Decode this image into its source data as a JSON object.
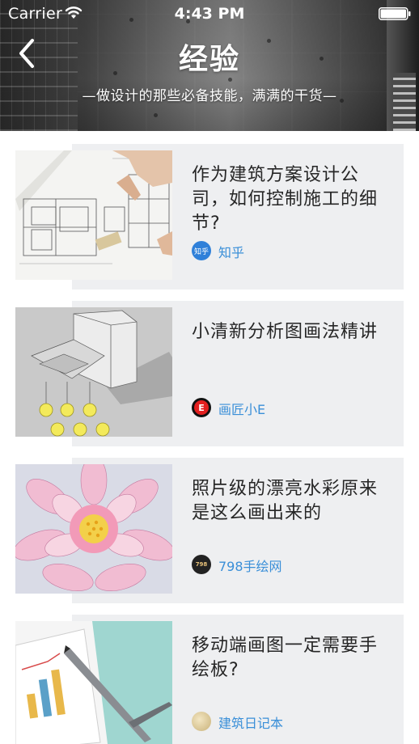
{
  "status_bar": {
    "carrier": "Carrier",
    "time": "4:43 PM"
  },
  "nav": {
    "back_icon": "chevron-left-icon",
    "title": "经验",
    "subtitle": "—做设计的那些必备技能，满满的干货—"
  },
  "colors": {
    "card_background": "#eeeff1",
    "source_link": "#3a8fd8",
    "title_text": "#262626"
  },
  "articles": [
    {
      "title": "作为建筑方案设计公司，如何控制施工的细节?",
      "source": "知乎",
      "avatar_text": "知乎",
      "avatar_color": "#2f80d9",
      "thumbnail": "architectural-blueprint-image"
    },
    {
      "title": "小清新分析图画法精讲",
      "source": "画匠小E",
      "avatar_text": "E",
      "avatar_color": "#111111",
      "thumbnail": "building-analysis-diagram-image"
    },
    {
      "title": "照片级的漂亮水彩原来是这么画出来的",
      "source": "798手绘网",
      "avatar_text": "798",
      "avatar_color": "#222222",
      "thumbnail": "watercolor-lotus-image"
    },
    {
      "title": "移动端画图一定需要手绘板?",
      "source": "建筑日记本",
      "avatar_text": "",
      "avatar_color": "#d9c79a",
      "thumbnail": "tablet-stylus-image"
    }
  ]
}
